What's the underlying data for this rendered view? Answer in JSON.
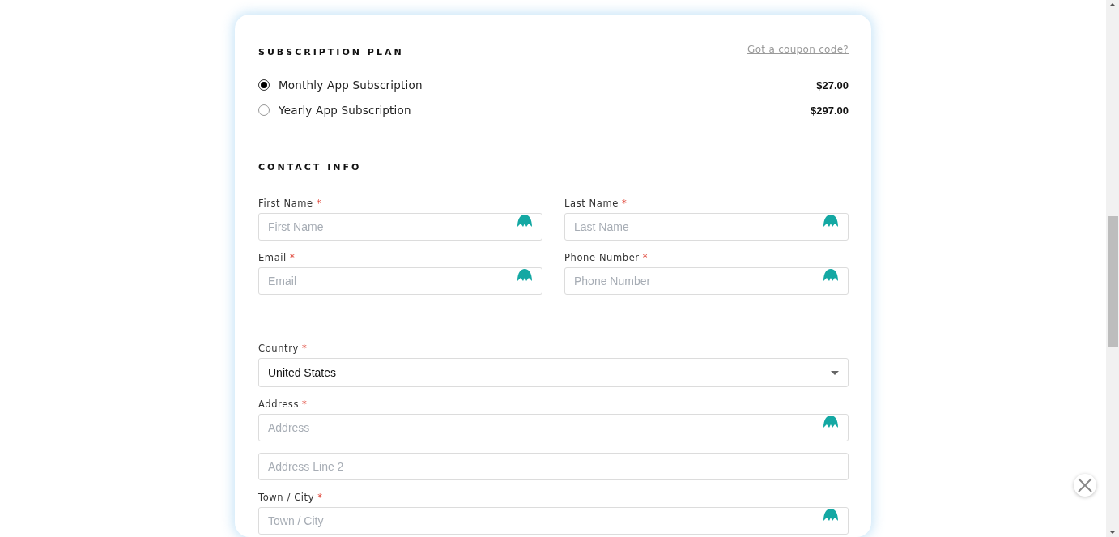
{
  "subscription": {
    "heading": "SUBSCRIPTION PLAN",
    "coupon_link": "Got a coupon code?",
    "plans": [
      {
        "label": "Monthly App Subscription",
        "price": "$27.00",
        "selected": true
      },
      {
        "label": "Yearly App Subscription",
        "price": "$297.00",
        "selected": false
      }
    ]
  },
  "contact": {
    "heading": "CONTACT INFO",
    "fields": [
      {
        "label": "First Name",
        "marker": "*",
        "placeholder": "First Name",
        "kind": "text"
      },
      {
        "label": "Last Name",
        "marker": "*",
        "placeholder": "Last Name",
        "kind": "text"
      },
      {
        "label": "Email",
        "marker": "*",
        "placeholder": "Email",
        "kind": "text"
      },
      {
        "label": "Phone Number",
        "marker": "*",
        "placeholder": "Phone Number",
        "kind": "text"
      }
    ]
  },
  "address": {
    "fields": [
      {
        "label": "Country",
        "marker": "*",
        "value": "United States",
        "kind": "select"
      },
      {
        "label": "Address",
        "marker": "*",
        "placeholder": "Address",
        "kind": "text"
      },
      {
        "placeholder": "Address Line 2",
        "kind": "plain"
      },
      {
        "label": "Town / City",
        "marker": "*",
        "placeholder": "Town / City",
        "kind": "text"
      }
    ]
  }
}
